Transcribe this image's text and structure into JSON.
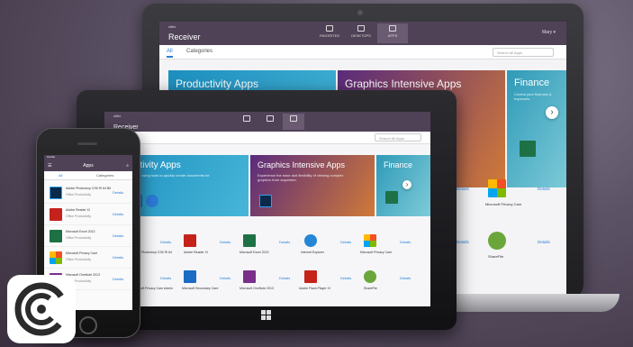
{
  "laptop": {
    "header": {
      "logo_small": "citrix",
      "logo_name": "Receiver",
      "nav": [
        {
          "label": "FAVORITES"
        },
        {
          "label": "DESKTOPS"
        },
        {
          "label": "APPS"
        }
      ],
      "user": "Mary ▾"
    },
    "tabs": {
      "all": "All",
      "categories": "Categories"
    },
    "search_placeholder": "Search All Apps",
    "banners": {
      "productivity": {
        "title": "Productivity Apps",
        "subtitle": "Get more done by using tools to quickly create documents for your work needs."
      },
      "graphics": {
        "title": "Graphics Intensive Apps",
        "subtitle": "Experience the ease and flexibility of viewing complex graphics from anywhere."
      },
      "finance": {
        "title": "Finance",
        "subtitle": "Control your finances & expenses."
      }
    },
    "apps": [
      {
        "name": "Microsoft Privacy Care",
        "details": "Details"
      },
      {
        "name": "ShareFile",
        "details": "Details"
      }
    ],
    "details_label": "Details"
  },
  "tablet": {
    "logo_small": "citrix",
    "logo_name": "Receiver",
    "search_placeholder": "Search All Apps",
    "banners": {
      "productivity": {
        "title": "Productivity Apps",
        "subtitle": "Get more done by using tools to quickly create documents for your work needs."
      },
      "graphics": {
        "title": "Graphics Intensive Apps",
        "subtitle": "Experience the ease and flexibility of viewing complex graphics from anywhere."
      },
      "finance": {
        "title": "Finance"
      }
    },
    "apps_row1": [
      "Adobe Photoshop CS6 RI 64",
      "Adobe Reader XI",
      "Microsoft Excel 2013",
      "Internet Explorer",
      "Microsoft Privacy Care"
    ],
    "apps_row2": [
      "Microsoft Privacy Care Admin",
      "Microsoft Secondary Care",
      "Microsoft OneNote 2013",
      "Adobe Flash Player XI",
      "ShareFile"
    ],
    "details_label": "Details"
  },
  "phone": {
    "status_left": "Carrier",
    "title": "Apps",
    "tabs": {
      "all": "All",
      "categories": "Categories"
    },
    "apps": [
      {
        "name": "Adobe Photoshop CS6 RI 64 Bit",
        "sub": "Office Productivity"
      },
      {
        "name": "Adobe Reader XI",
        "sub": "Office Productivity"
      },
      {
        "name": "Microsoft Excel 2013",
        "sub": "Office Productivity"
      },
      {
        "name": "Microsoft Privacy Care",
        "sub": "Office Productivity"
      },
      {
        "name": "Microsoft OneNote 2013",
        "sub": "Office Productivity"
      }
    ],
    "details_label": "Details"
  },
  "colors": {
    "header": "#4f4257",
    "accent": "#2a7fd4",
    "productivity": "#1d8fbf",
    "graphics": "#5a2b7c"
  },
  "icons": [
    "photoshop-icon",
    "outlook-icon",
    "onedrive-icon",
    "excel-icon",
    "adobe-reader-icon",
    "internet-explorer-icon",
    "sharefile-icon",
    "microsoft-icon",
    "windows-icon",
    "citrix-logo"
  ]
}
